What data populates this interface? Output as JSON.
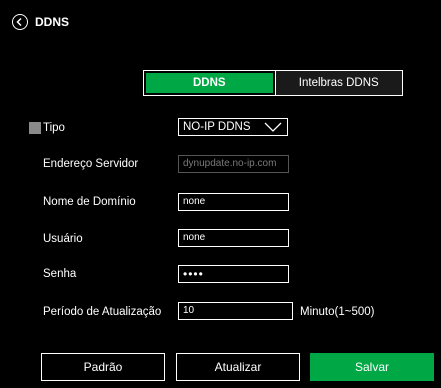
{
  "header": {
    "title": "DDNS",
    "back_icon": "chevron-left-icon"
  },
  "tabs": [
    {
      "label": "DDNS",
      "active": true
    },
    {
      "label": "Intelbras DDNS",
      "active": false
    }
  ],
  "form": {
    "type": {
      "label": "Tipo",
      "checked": false,
      "selected": "NO-IP DDNS",
      "options": [
        "NO-IP DDNS"
      ]
    },
    "server": {
      "label": "Endereço Servidor",
      "value": "dynupdate.no-ip.com"
    },
    "domain": {
      "label": "Nome de Domínio",
      "value": "none"
    },
    "user": {
      "label": "Usuário",
      "value": "none"
    },
    "password": {
      "label": "Senha",
      "value": "••••"
    },
    "interval": {
      "label": "Período de Atualização",
      "value": "10",
      "unit": "Minuto(1~500)"
    }
  },
  "buttons": {
    "default": "Padrão",
    "refresh": "Atualizar",
    "save": "Salvar"
  },
  "colors": {
    "accent": "#00a845",
    "background": "#000000",
    "disabled_text": "#7a7a7a"
  }
}
